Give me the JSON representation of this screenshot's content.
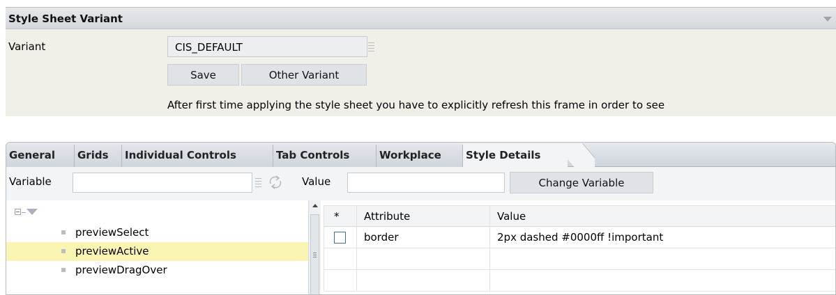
{
  "variant_panel": {
    "title": "Style Sheet Variant",
    "variant_label": "Variant",
    "variant_value": "CIS_DEFAULT",
    "save_label": "Save",
    "other_variant_label": "Other Variant",
    "hint": "After first time applying the style sheet you have to explicitly refresh this frame in order to see"
  },
  "tabs": [
    {
      "label": "General"
    },
    {
      "label": "Grids"
    },
    {
      "label": "Individual Controls"
    },
    {
      "label": "Tab Controls"
    },
    {
      "label": "Workplace"
    },
    {
      "label": "Style Details",
      "active": true
    }
  ],
  "toolbar": {
    "variable_label": "Variable",
    "variable_value": "",
    "value_label": "Value",
    "value_value": "",
    "change_variable_label": "Change Variable"
  },
  "tree": {
    "items": [
      {
        "label": "previewSelect"
      },
      {
        "label": "previewActive",
        "selected": true
      },
      {
        "label": "previewDragOver"
      }
    ]
  },
  "table": {
    "columns": [
      "*",
      "Attribute",
      "Value"
    ],
    "rows": [
      {
        "selected": false,
        "attribute": "border",
        "value": "2px dashed #0000ff !important"
      },
      {
        "selected": null,
        "attribute": "",
        "value": ""
      },
      {
        "selected": null,
        "attribute": "",
        "value": ""
      }
    ]
  },
  "icons": [
    "collapse-triangle-icon",
    "value-help-icon",
    "refresh-icon",
    "expand-icon",
    "folder-icon",
    "bullet-icon",
    "scroll-up-icon"
  ],
  "colors": {
    "selected_row": "#fbf5b4",
    "panel_bg": "#f1f0e8",
    "button_bg": "#dfe2e7"
  }
}
